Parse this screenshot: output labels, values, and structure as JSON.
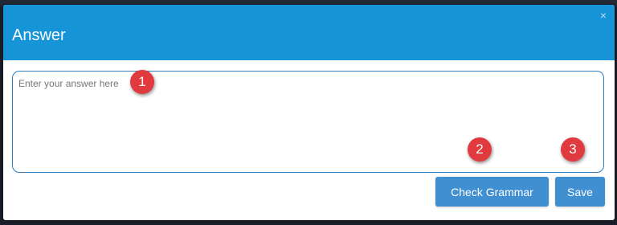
{
  "dialog": {
    "title": "Answer",
    "close_glyph": "×"
  },
  "answer": {
    "placeholder": "Enter your answer here",
    "value": ""
  },
  "buttons": {
    "check_grammar": "Check Grammar",
    "save": "Save"
  },
  "markers": [
    "1",
    "2",
    "3"
  ],
  "colors": {
    "header": "#1594d8",
    "button": "#3f8fd1",
    "marker": "#e03a3e",
    "input_border": "#2f7fc0"
  }
}
